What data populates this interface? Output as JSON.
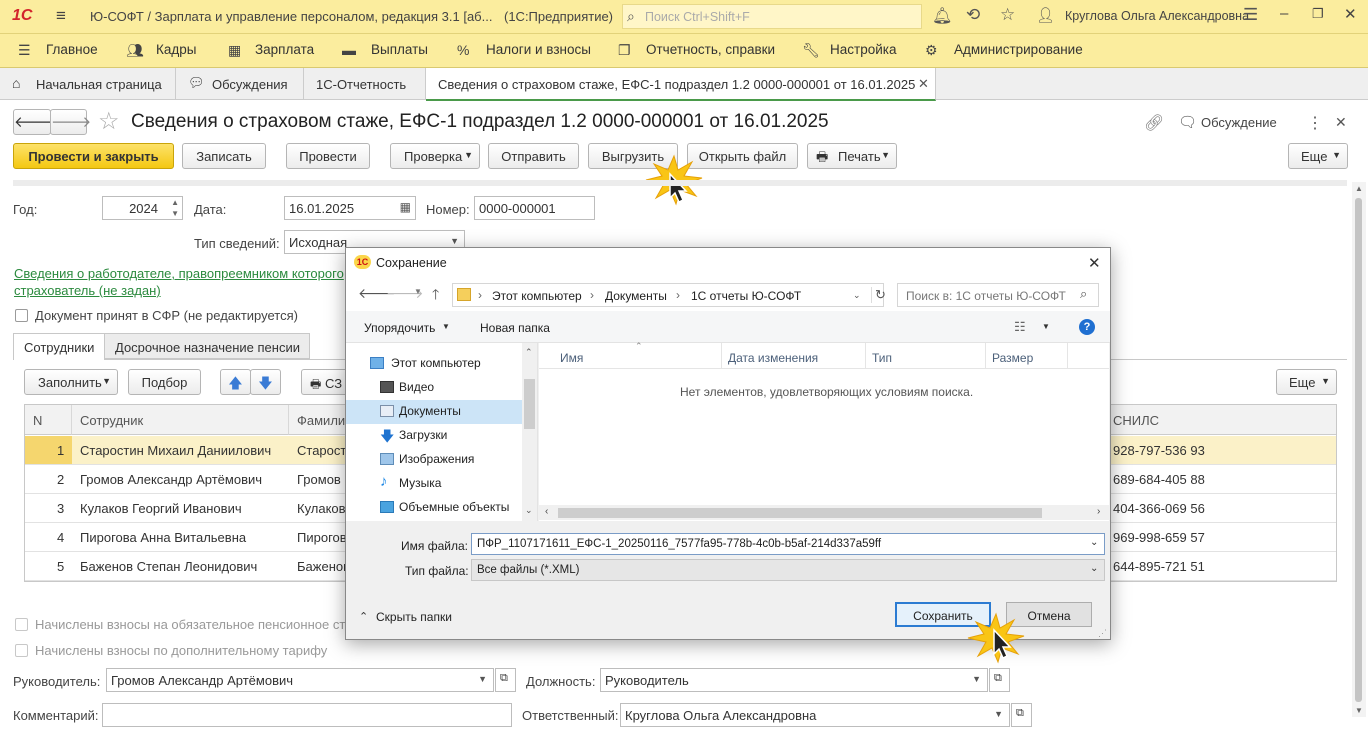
{
  "titlebar": {
    "logo": "1С",
    "title": "Ю-СОФТ / Зарплата и управление персоналом, редакция 3.1 [аб...",
    "platform": "(1С:Предприятие)",
    "search_placeholder": "Поиск Ctrl+Shift+F",
    "user": "Круглова Ольга Александровна"
  },
  "menu": [
    "Главное",
    "Кадры",
    "Зарплата",
    "Выплаты",
    "Налоги и взносы",
    "Отчетность, справки",
    "Настройка",
    "Администрирование"
  ],
  "tabs": [
    "Начальная страница",
    "Обсуждения",
    "1С-Отчетность",
    "Сведения о страховом стаже, ЕФС-1 подраздел 1.2 0000-000001 от 16.01.2025"
  ],
  "doc": {
    "title": "Сведения о страховом стаже, ЕФС-1 подраздел 1.2 0000-000001 от 16.01.2025",
    "discussion": "Обсуждение"
  },
  "toolbar": {
    "post_close": "Провести и закрыть",
    "save": "Записать",
    "post": "Провести",
    "check": "Проверка",
    "send": "Отправить",
    "export": "Выгрузить",
    "open_file": "Открыть файл",
    "print": "Печать",
    "more": "Еще"
  },
  "form": {
    "year_label": "Год:",
    "year": "2024",
    "date_label": "Дата:",
    "date": "16.01.2025",
    "number_label": "Номер:",
    "number": "0000-000001",
    "type_label": "Тип сведений:",
    "type": "Исходная",
    "employer_link_1": "Сведения о работодателе, правопреемником которого",
    "employer_link_2": "страхователь (не задан)",
    "accepted_sfr": "Документ принят в СФР (не редактируется)"
  },
  "subtabs": [
    "Сотрудники",
    "Досрочное назначение пенсии"
  ],
  "grid_toolbar": {
    "fill": "Заполнить",
    "select": "Подбор",
    "sz": "СЗ",
    "more": "Еще"
  },
  "grid": {
    "headers": {
      "n": "N",
      "employee": "Сотрудник",
      "surname": "Фамили",
      "snils": "СНИЛС"
    },
    "rows": [
      {
        "n": "1",
        "employee": "Старостин Михаил Даниилович",
        "surname": "Старост",
        "snils": "928-797-536 93"
      },
      {
        "n": "2",
        "employee": "Громов Александр Артёмович",
        "surname": "Громов",
        "snils": "689-684-405 88"
      },
      {
        "n": "3",
        "employee": "Кулаков Георгий Иванович",
        "surname": "Кулаков",
        "snils": "404-366-069 56"
      },
      {
        "n": "4",
        "employee": "Пирогова Анна Витальевна",
        "surname": "Пирогов",
        "snils": "969-998-659 57"
      },
      {
        "n": "5",
        "employee": "Баженов Степан Леонидович",
        "surname": "Баженов",
        "snils": "644-895-721 51"
      }
    ]
  },
  "bottom": {
    "chk_pension": "Начислены взносы на обязательное пенсионное стр",
    "chk_extra": "Начислены взносы по дополнительному тарифу",
    "head_label": "Руководитель:",
    "head": "Громов Александр Артёмович",
    "position_label": "Должность:",
    "position": "Руководитель",
    "comment_label": "Комментарий:",
    "responsible_label": "Ответственный:",
    "responsible": "Круглова Ольга Александровна"
  },
  "dialog": {
    "title": "Сохранение",
    "path": [
      "Этот компьютер",
      "Документы",
      "1С отчеты Ю-СОФТ"
    ],
    "search_placeholder": "Поиск в: 1С отчеты Ю-СОФТ",
    "organize": "Упорядочить",
    "new_folder": "Новая папка",
    "nav": [
      "Этот компьютер",
      "Видео",
      "Документы",
      "Загрузки",
      "Изображения",
      "Музыка",
      "Объемные объекты"
    ],
    "columns": [
      "Имя",
      "Дата изменения",
      "Тип",
      "Размер"
    ],
    "empty": "Нет элементов, удовлетворяющих условиям поиска.",
    "filename_label": "Имя файла:",
    "filename": "ПФР_1107171611_ЕФС-1_20250116_7577fa95-778b-4c0b-b5af-214d337a59ff",
    "filetype_label": "Тип файла:",
    "filetype": "Все файлы (*.XML)",
    "hide_folders": "Скрыть папки",
    "save": "Сохранить",
    "cancel": "Отмена"
  }
}
